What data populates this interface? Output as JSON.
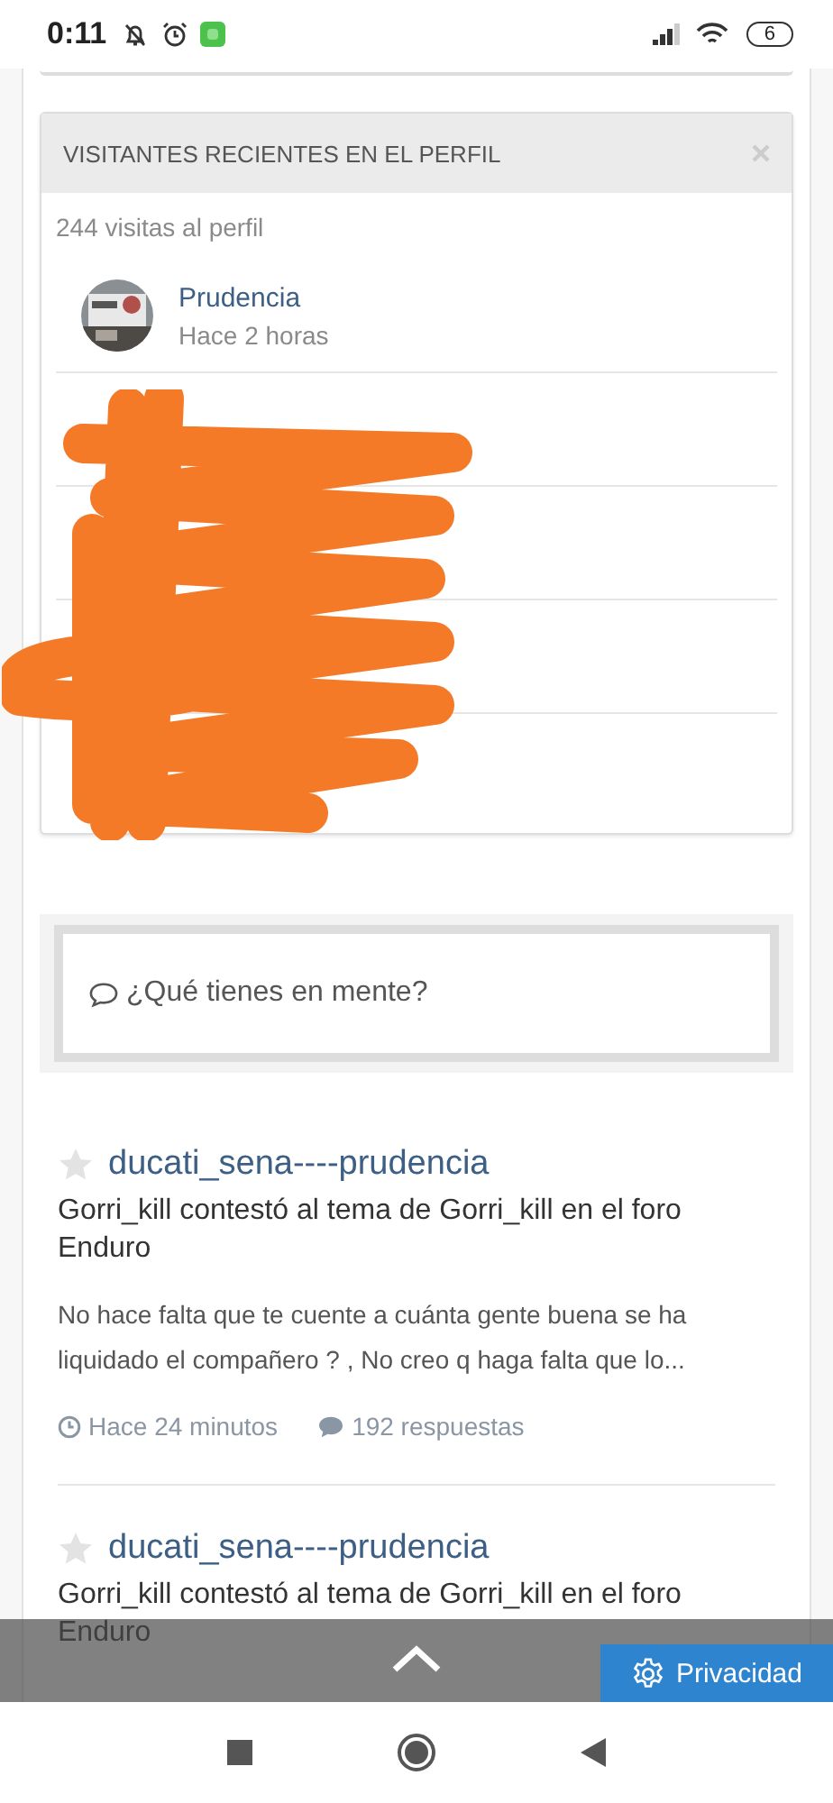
{
  "status_bar": {
    "time": "0:11",
    "battery": "6"
  },
  "visitors": {
    "title": "VISITANTES RECIENTES EN EL PERFIL",
    "count": "244 visitas al perfil",
    "items": [
      {
        "name": "Prudencia",
        "time": "Hace 2 horas"
      },
      {
        "kind": "hidden"
      },
      {
        "kind": "hidden"
      },
      {
        "kind": "hidden"
      },
      {
        "kind": "hidden"
      }
    ]
  },
  "composer": {
    "placeholder": "¿Qué tienes en mente?"
  },
  "posts": [
    {
      "title": "ducati_sena----prudencia",
      "starred": false,
      "summary": "Gorri_kill contestó al tema de Gorri_kill en el foro Enduro",
      "excerpt": "No hace falta que te cuente a cuánta gente buena se ha liquidado el compañero ? , No creo q haga falta que lo...",
      "time": "Hace 24 minutos",
      "replies": "192 respuestas"
    },
    {
      "title": "ducati_sena----prudencia",
      "starred": false,
      "summary": "Gorri_kill contestó al tema de Gorri_kill en el foro Enduro"
    }
  ],
  "privacy_button": "Privacidad"
}
